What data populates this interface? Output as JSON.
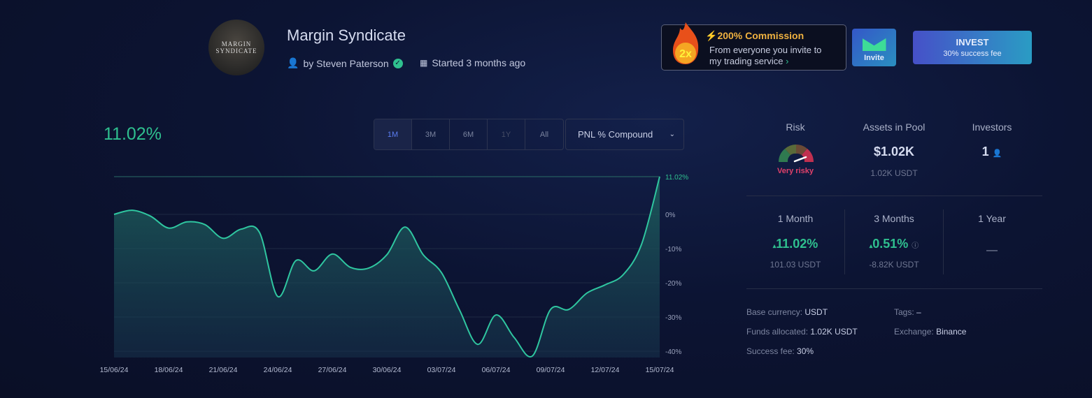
{
  "header": {
    "avatar_text": "MARGIN SYNDICATE",
    "title": "Margin Syndicate",
    "author": "by Steven Paterson",
    "started": "Started 3 months ago"
  },
  "promo": {
    "badge": "2x",
    "title": "200% Commission",
    "line1": "From everyone you invite to",
    "line2": "my trading service",
    "invite_label": "Invite"
  },
  "invest": {
    "label": "INVEST",
    "sub": "30% success fee"
  },
  "chart_header": {
    "value": "11.02%",
    "ranges": [
      "1M",
      "3M",
      "6M",
      "1Y",
      "All"
    ],
    "selected_range": "1M",
    "metric": "PNL % Compound"
  },
  "stats": {
    "risk_label": "Risk",
    "risk_value": "Very risky",
    "risk_level": 0.85,
    "assets_label": "Assets in Pool",
    "assets_value": "$1.02K",
    "assets_sub": "1.02K USDT",
    "investors_label": "Investors",
    "investors_value": "1",
    "periods": [
      {
        "label": "1 Month",
        "value": "11.02%",
        "sub": "101.03 USDT"
      },
      {
        "label": "3 Months",
        "value": "0.51%",
        "sub": "-8.82K USDT"
      },
      {
        "label": "1 Year",
        "value": "—"
      }
    ],
    "details": {
      "base_k": "Base currency:",
      "base_v": "USDT",
      "funds_k": "Funds allocated:",
      "funds_v": "1.02K USDT",
      "fee_k": "Success fee:",
      "fee_v": "30%",
      "tags_k": "Tags:",
      "tags_v": "–",
      "exch_k": "Exchange:",
      "exch_v": "Binance"
    }
  },
  "colors": {
    "accent": "#2fc08f",
    "risk": "#e0406a",
    "invest_from": "#4650c8",
    "invest_to": "#2a9cc4"
  },
  "chart_data": {
    "type": "area",
    "ylim": [
      -42,
      11.02
    ],
    "grid": true,
    "x_ticks": [
      "15/06/24",
      "18/06/24",
      "21/06/24",
      "24/06/24",
      "27/06/24",
      "30/06/24",
      "03/07/24",
      "06/07/24",
      "09/07/24",
      "12/07/24",
      "15/07/24"
    ],
    "y_ticks": [
      "11.02%",
      "0%",
      "-10%",
      "-20%",
      "-30%",
      "-40%"
    ],
    "y_tick_values": [
      11.02,
      0,
      -10,
      -20,
      -30,
      -40
    ],
    "points": [
      [
        "15/06/24",
        0
      ],
      [
        "16/06/24",
        1.2
      ],
      [
        "17/06/24",
        -0.5
      ],
      [
        "18/06/24",
        -4
      ],
      [
        "19/06/24",
        -2.2
      ],
      [
        "20/06/24",
        -3
      ],
      [
        "21/06/24",
        -7
      ],
      [
        "22/06/24",
        -4.3
      ],
      [
        "23/06/24",
        -5.3
      ],
      [
        "24/06/24",
        -24
      ],
      [
        "25/06/24",
        -13.5
      ],
      [
        "26/06/24",
        -16.5
      ],
      [
        "27/06/24",
        -11.6
      ],
      [
        "28/06/24",
        -15.5
      ],
      [
        "29/06/24",
        -15.7
      ],
      [
        "30/06/24",
        -11.8
      ],
      [
        "01/07/24",
        -3.7
      ],
      [
        "02/07/24",
        -11.8
      ],
      [
        "03/07/24",
        -17
      ],
      [
        "04/07/24",
        -28
      ],
      [
        "05/07/24",
        -38
      ],
      [
        "06/07/24",
        -29.4
      ],
      [
        "07/07/24",
        -36
      ],
      [
        "08/07/24",
        -41.4
      ],
      [
        "09/07/24",
        -27.8
      ],
      [
        "10/07/24",
        -27.8
      ],
      [
        "11/07/24",
        -23
      ],
      [
        "12/07/24",
        -20.6
      ],
      [
        "13/07/24",
        -17.6
      ],
      [
        "14/07/24",
        -8.8
      ],
      [
        "15/07/24",
        11.02
      ]
    ]
  }
}
